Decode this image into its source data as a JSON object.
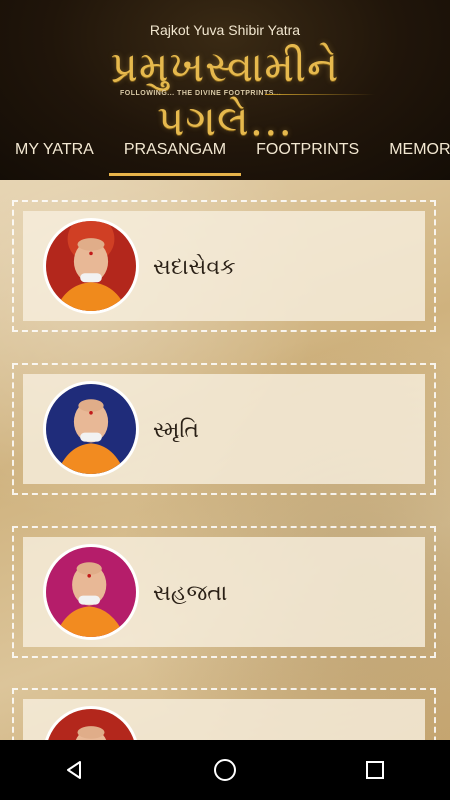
{
  "header": {
    "subtitle": "Rajkot Yuva Shibir Yatra",
    "logo_text": "પ્રમુખસ્વામીને પગલે...",
    "logo_tagline": "FOLLOWING... THE DIVINE FOOTPRINTS..."
  },
  "tabs": [
    {
      "label": "MY YATRA"
    },
    {
      "label": "PRASANGAM",
      "active": true
    },
    {
      "label": "FOOTPRINTS"
    },
    {
      "label": "MEMORIES"
    }
  ],
  "cards": [
    {
      "label": "સદાસેવક",
      "bg": "#b3271c"
    },
    {
      "label": "સ્મૃતિ",
      "bg": "#1f2c7a"
    },
    {
      "label": "સહજતા",
      "bg": "#b51d6a"
    },
    {
      "label": "",
      "bg": "#b3271c"
    }
  ],
  "navbar": {
    "back_icon": "back-triangle-icon",
    "home_icon": "home-circle-icon",
    "recents_icon": "recents-square-icon"
  },
  "colors": {
    "accent": "#e8b44a",
    "header_bg": "#20150a"
  }
}
